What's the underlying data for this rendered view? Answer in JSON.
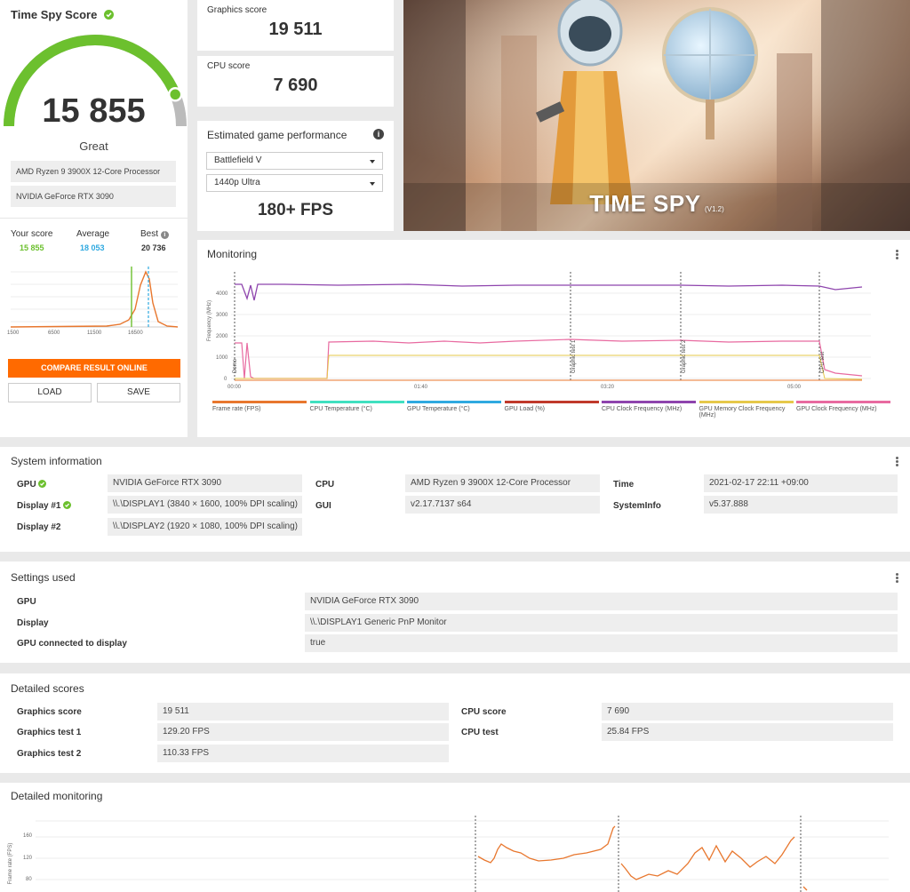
{
  "score_panel": {
    "title": "Time Spy Score",
    "score": "15 855",
    "rating": "Great",
    "gauge_fraction": 0.88,
    "cpu": "AMD Ryzen 9 3900X 12-Core Processor",
    "gpu": "NVIDIA GeForce RTX 3090",
    "your_score_label": "Your score",
    "your_score": "15 855",
    "average_label": "Average",
    "average": "18 053",
    "best_label": "Best",
    "best": "20 736",
    "dist_ticks": [
      "1500",
      "6500",
      "11500",
      "16500"
    ],
    "compare_label": "COMPARE RESULT ONLINE",
    "load_label": "LOAD",
    "save_label": "SAVE",
    "accent": "#ff6a00",
    "green": "#6cc02e",
    "blue": "#2fa9e0"
  },
  "graphics_score": {
    "label": "Graphics score",
    "value": "19 511"
  },
  "cpu_score": {
    "label": "CPU score",
    "value": "7 690"
  },
  "game_perf": {
    "title": "Estimated game performance",
    "game": "Battlefield V",
    "preset": "1440p Ultra",
    "fps": "180+ FPS"
  },
  "banner": {
    "title": "TIME SPY",
    "version": "(V1.2)"
  },
  "monitoring": {
    "title": "Monitoring",
    "y_label": "Frequency (MHz)",
    "y_ticks": [
      "4000",
      "3000",
      "2000",
      "1000",
      "0"
    ],
    "x_ticks": [
      "00:00",
      "01:40",
      "03:20",
      "05:00"
    ],
    "markers": [
      "Demo",
      "Graphic test 1",
      "Graphic test 2",
      "CPU test"
    ],
    "legend": [
      {
        "label": "Frame rate (FPS)",
        "color": "#e8772e"
      },
      {
        "label": "CPU Temperature (°C)",
        "color": "#40e0c0"
      },
      {
        "label": "GPU Temperature (°C)",
        "color": "#2fa9e0"
      },
      {
        "label": "GPU Load (%)",
        "color": "#c0392b"
      },
      {
        "label": "CPU Clock Frequency (MHz)",
        "color": "#8e44ad"
      },
      {
        "label": "GPU Memory Clock Frequency (MHz)",
        "color": "#e6c84a"
      },
      {
        "label": "GPU Clock Frequency (MHz)",
        "color": "#e86aa0"
      }
    ]
  },
  "system_info": {
    "title": "System information",
    "gpu_label": "GPU",
    "gpu": "NVIDIA GeForce RTX 3090",
    "display1_label": "Display #1",
    "display1": "\\\\.\\DISPLAY1 (3840 × 1600, 100% DPI scaling)",
    "display2_label": "Display #2",
    "display2": "\\\\.\\DISPLAY2 (1920 × 1080, 100% DPI scaling)",
    "cpu_label": "CPU",
    "cpu": "AMD Ryzen 9 3900X 12-Core Processor",
    "gui_label": "GUI",
    "gui": "v2.17.7137 s64",
    "time_label": "Time",
    "time": "2021-02-17 22:11 +09:00",
    "sysinfo_label": "SystemInfo",
    "sysinfo": "v5.37.888"
  },
  "settings": {
    "title": "Settings used",
    "gpu_label": "GPU",
    "gpu": "NVIDIA GeForce RTX 3090",
    "display_label": "Display",
    "display": "\\\\.\\DISPLAY1 Generic PnP Monitor",
    "connected_label": "GPU connected to display",
    "connected": "true"
  },
  "detailed_scores": {
    "title": "Detailed scores",
    "graphics_score_label": "Graphics score",
    "graphics_score": "19 511",
    "gt1_label": "Graphics test 1",
    "gt1": "129.20 FPS",
    "gt2_label": "Graphics test 2",
    "gt2": "110.33 FPS",
    "cpu_score_label": "CPU score",
    "cpu_score": "7 690",
    "cpu_test_label": "CPU test",
    "cpu_test": "25.84 FPS"
  },
  "detailed_monitoring": {
    "title": "Detailed monitoring",
    "y_label": "Frame rate (FPS)",
    "y_ticks": [
      "160",
      "120",
      "80"
    ]
  }
}
